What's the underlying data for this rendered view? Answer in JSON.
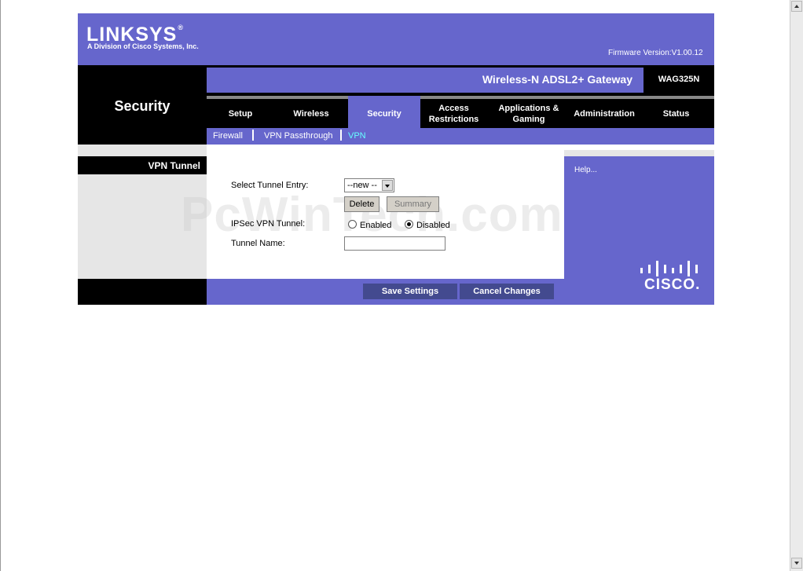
{
  "brand": {
    "logo": "LINKSYS",
    "logo_mark": "®",
    "subtitle": "A Division of Cisco Systems, Inc.",
    "firmware": "Firmware Version:V1.00.12"
  },
  "product": {
    "name": "Wireless-N ADSL2+ Gateway",
    "model": "WAG325N"
  },
  "section_title": "Security",
  "tabs": [
    {
      "label": "Setup"
    },
    {
      "label": "Wireless"
    },
    {
      "label": "Security"
    },
    {
      "label": "Access\nRestrictions"
    },
    {
      "label": "Applications &\nGaming"
    },
    {
      "label": "Administration"
    },
    {
      "label": "Status"
    }
  ],
  "subtabs": [
    {
      "label": "Firewall"
    },
    {
      "label": "VPN Passthrough"
    },
    {
      "label": "VPN"
    }
  ],
  "left_label": "VPN Tunnel",
  "form": {
    "select_tunnel_label": "Select Tunnel Entry:",
    "select_tunnel_value": "--new --",
    "delete_label": "Delete",
    "summary_label": "Summary",
    "ipsec_label": "IPSec VPN Tunnel:",
    "enabled_label": "Enabled",
    "disabled_label": "Disabled",
    "tunnel_name_label": "Tunnel Name:",
    "tunnel_name_value": ""
  },
  "help": {
    "link": "Help..."
  },
  "cisco_word": "CISCO.",
  "footer": {
    "save": "Save Settings",
    "cancel": "Cancel Changes"
  },
  "watermark": "PcWinTech.com"
}
